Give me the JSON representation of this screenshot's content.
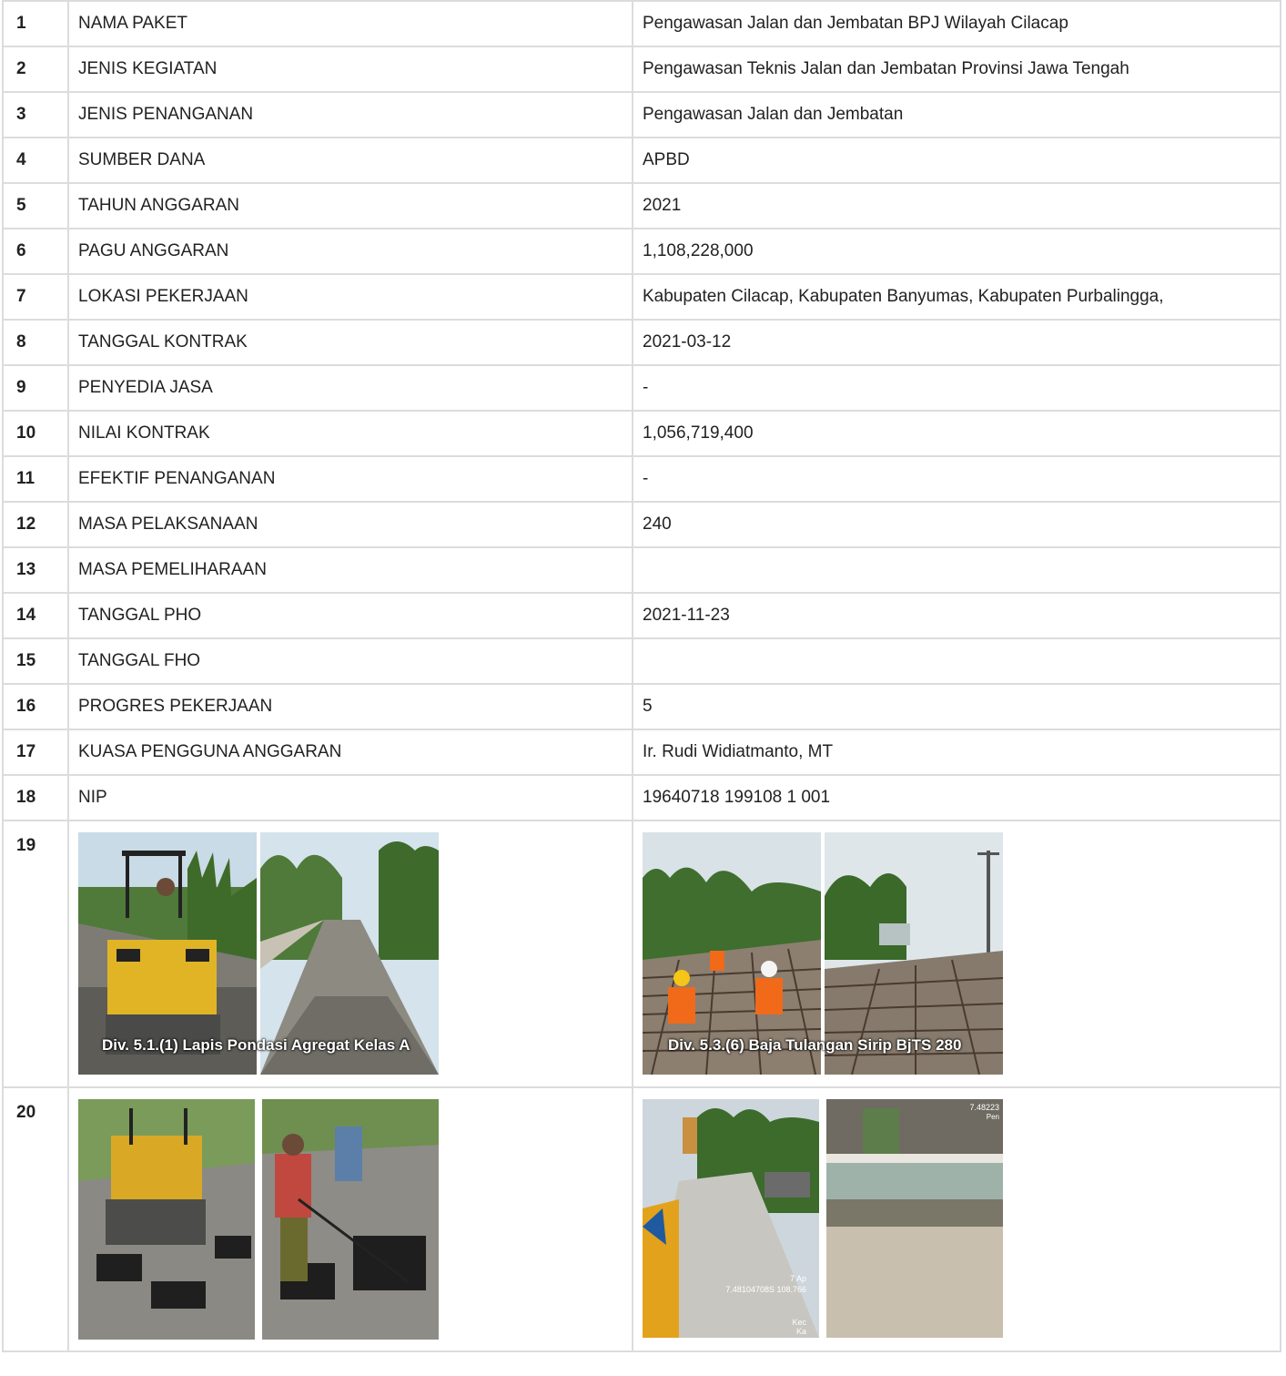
{
  "rows": [
    {
      "no": "1",
      "label": "NAMA PAKET",
      "value": "Pengawasan Jalan dan Jembatan BPJ Wilayah Cilacap"
    },
    {
      "no": "2",
      "label": "JENIS KEGIATAN",
      "value": "Pengawasan Teknis Jalan dan Jembatan Provinsi Jawa Tengah"
    },
    {
      "no": "3",
      "label": "JENIS PENANGANAN",
      "value": "Pengawasan Jalan dan Jembatan"
    },
    {
      "no": "4",
      "label": "SUMBER DANA",
      "value": "APBD"
    },
    {
      "no": "5",
      "label": "TAHUN ANGGARAN",
      "value": "2021"
    },
    {
      "no": "6",
      "label": "PAGU ANGGARAN",
      "value": "1,108,228,000"
    },
    {
      "no": "7",
      "label": "LOKASI PEKERJAAN",
      "value": "Kabupaten Cilacap, Kabupaten Banyumas, Kabupaten Purbalingga,"
    },
    {
      "no": "8",
      "label": "TANGGAL KONTRAK",
      "value": "2021-03-12"
    },
    {
      "no": "9",
      "label": "PENYEDIA JASA",
      "value": "-"
    },
    {
      "no": "10",
      "label": "NILAI KONTRAK",
      "value": "1,056,719,400"
    },
    {
      "no": "11",
      "label": "EFEKTIF PENANGANAN",
      "value": "-"
    },
    {
      "no": "12",
      "label": "MASA PELAKSANAAN",
      "value": "240"
    },
    {
      "no": "13",
      "label": "MASA PEMELIHARAAN",
      "value": ""
    },
    {
      "no": "14",
      "label": "TANGGAL PHO",
      "value": "2021-11-23"
    },
    {
      "no": "15",
      "label": "TANGGAL FHO",
      "value": ""
    },
    {
      "no": "16",
      "label": "PROGRES PEKERJAAN",
      "value": "5"
    },
    {
      "no": "17",
      "label": "KUASA PENGGUNA ANGGARAN",
      "value": "Ir. Rudi Widiatmanto, MT"
    },
    {
      "no": "18",
      "label": "NIP",
      "value": "19640718 199108 1 001"
    }
  ],
  "photo_rows": [
    {
      "no": "19",
      "left_caption": "Div. 5.1.(1) Lapis Pondasi Agregat Kelas A",
      "right_caption": "Div. 5.3.(6) Baja Tulangan Sirip BjTS 280"
    },
    {
      "no": "20",
      "left_caption": "",
      "right_caption": ""
    }
  ],
  "photo_stamp": {
    "line1": "7 Ap",
    "line2": "7.48104708S 108.766",
    "line3": "Kec",
    "line4": "Ka",
    "corner": "7.48223",
    "corner2": "Pen"
  }
}
